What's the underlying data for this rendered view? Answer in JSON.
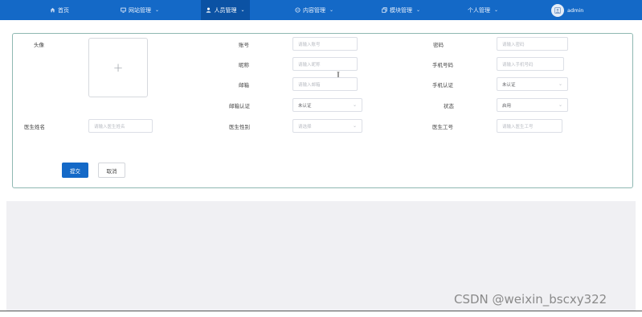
{
  "nav": {
    "home": "首页",
    "site": "网站管理",
    "people": "人员管理",
    "content": "内容管理",
    "module": "模块管理",
    "personal": "个人管理",
    "user": "admin"
  },
  "form": {
    "avatar_label": "头像",
    "upload_plus": "+",
    "account_label": "账号",
    "account_placeholder": "请输入账号",
    "password_label": "密码",
    "password_placeholder": "请输入密码",
    "nickname_label": "昵称",
    "nickname_placeholder": "请输入昵称",
    "phone_label": "手机号码",
    "phone_placeholder": "请输入手机号码",
    "email_label": "邮箱",
    "email_placeholder": "请输入邮箱",
    "phone_verify_label": "手机认证",
    "phone_verify_value": "未认证",
    "email_verify_label": "邮箱认证",
    "email_verify_value": "未认证",
    "status_label": "状态",
    "status_value": "启用",
    "doctor_name_label": "医生姓名",
    "doctor_name_placeholder": "请输入医生姓名",
    "doctor_gender_label": "医生性别",
    "doctor_gender_placeholder": "请选择",
    "doctor_id_label": "医生工号",
    "doctor_id_placeholder": "请输入医生工号",
    "cursor": "I",
    "submit": "提交",
    "cancel": "取消"
  },
  "watermark": "CSDN @weixin_bscxy322",
  "colors": {
    "nav_bg": "#1469c7",
    "nav_active": "#0b52a4",
    "card_border": "#8fb8b2",
    "primary": "#1469c7"
  },
  "icons": [
    "home-icon",
    "monitor-icon",
    "user-icon",
    "chat-icon",
    "copy-icon",
    "chevron-down-icon",
    "avatar-icon"
  ]
}
